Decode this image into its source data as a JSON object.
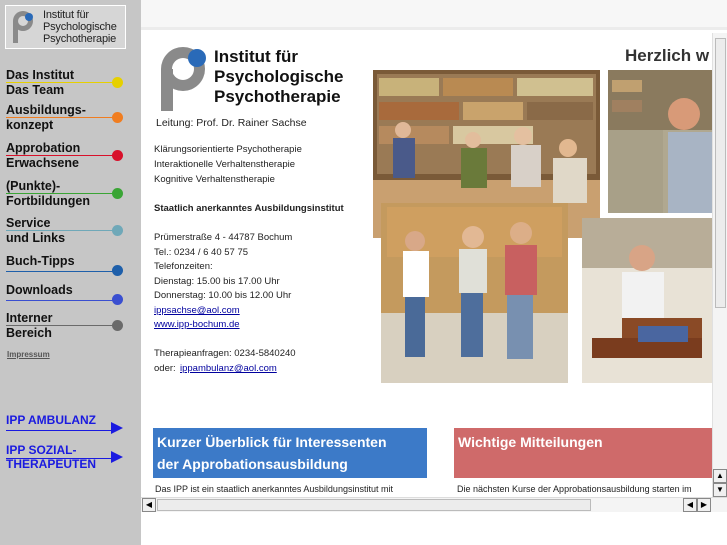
{
  "sidebar": {
    "logo_lines": [
      "Institut für",
      "Psychologische",
      "Psychotherapie"
    ],
    "nav": [
      {
        "lines": [
          "Das Institut",
          "Das Team"
        ],
        "color": "#e6d000"
      },
      {
        "lines": [
          "Ausbildungs-",
          "konzept"
        ],
        "color": "#f07d20"
      },
      {
        "lines": [
          "Approbation",
          "Erwachsene"
        ],
        "color": "#d8102a"
      },
      {
        "lines": [
          "(Punkte)-",
          "Fortbildungen"
        ],
        "color": "#3aa535"
      },
      {
        "lines": [
          "Service",
          "und Links"
        ],
        "color": "#6fa8b8"
      },
      {
        "lines": [
          "Buch-Tipps"
        ],
        "color": "#1e5faa"
      },
      {
        "lines": [
          "Downloads"
        ],
        "color": "#3a4fd0"
      },
      {
        "lines": [
          "Interner",
          "Bereich"
        ],
        "color": "#6a6a6a"
      }
    ],
    "impressum": "Impressum",
    "links": [
      {
        "lines": [
          "IPP AMBULANZ"
        ]
      },
      {
        "lines": [
          "IPP SOZIAL-",
          "THERAPEUTEN"
        ]
      }
    ]
  },
  "main": {
    "logo_lines": [
      "Institut für",
      "Psychologische",
      "Psychotherapie"
    ],
    "leitung": "Leitung: Prof. Dr. Rainer Sachse",
    "therapies": [
      "Klärungsorientierte Psychotherapie",
      "Interaktionelle Verhaltenstherapie",
      "Kognitive Verhaltenstherapie"
    ],
    "accredited": "Staatlich anerkanntes Ausbildungsinstitut",
    "address": "Prümerstraße 4 - 44787 Bochum",
    "tel": "Tel.: 0234 / 6 40 57 75",
    "hours_label": "Telefonzeiten:",
    "hours": [
      "Dienstag: 15.00 bis 17.00 Uhr",
      "Donnerstag: 10.00 bis 12.00 Uhr"
    ],
    "email": "ippsachse@aol.com",
    "web": "www.ipp-bochum.de",
    "therapy_inquiries": "Therapieanfragen: 0234-5840240",
    "or_label": "oder:",
    "ambulanz_email": "ippambulanz@aol.com",
    "welcome": "Herzlich w",
    "box_left": {
      "lines": [
        "Kurzer Überblick für Interessenten",
        "der Approbationsausbildung"
      ],
      "color": "#3c7ac8",
      "text": "Das IPP ist ein staatlich anerkanntes Ausbildungsinstitut mit"
    },
    "box_right": {
      "lines": [
        "Wichtige Mitteilungen"
      ],
      "color": "#cf6a6a",
      "text": "Die nächsten Kurse der Approbationsausbildung starten im"
    }
  },
  "scroll": {
    "up": "▲",
    "down": "▼",
    "left": "◀",
    "right": "▶"
  }
}
